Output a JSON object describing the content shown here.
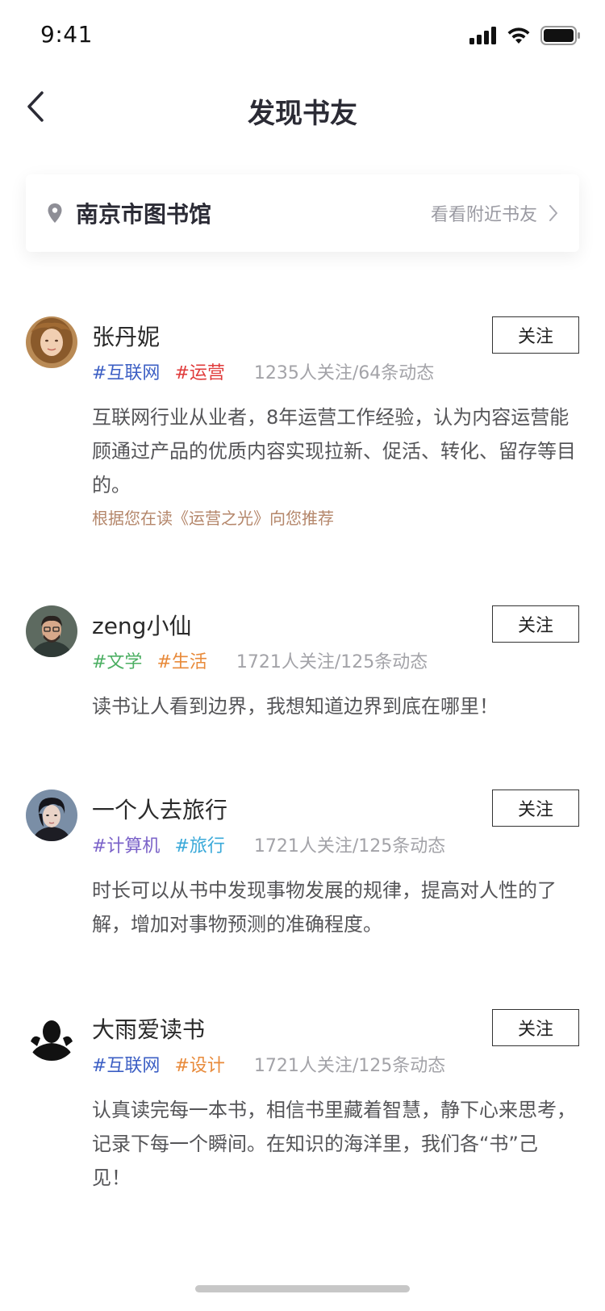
{
  "status_bar": {
    "time": "9:41"
  },
  "header": {
    "title": "发现书友"
  },
  "location": {
    "name": "南京市图书馆",
    "nearby_link": "看看附近书友"
  },
  "users": [
    {
      "name": "张丹妮",
      "tags": [
        {
          "text": "#互联网",
          "color": "#3c5fc4"
        },
        {
          "text": "#运营",
          "color": "#e03b3b"
        }
      ],
      "stats": "1235人关注/64条动态",
      "bio": "互联网行业从业者，8年运营工作经验，认为内容运营能顾通过产品的优质内容实现拉新、促活、转化、留存等目的。",
      "recommendation": "根据您在读《运营之光》向您推荐",
      "follow_label": "关注"
    },
    {
      "name": "zeng小仙",
      "tags": [
        {
          "text": "#文学",
          "color": "#4caf63"
        },
        {
          "text": "#生活",
          "color": "#e88a3a"
        }
      ],
      "stats": "1721人关注/125条动态",
      "bio": "读书让人看到边界，我想知道边界到底在哪里！",
      "follow_label": "关注"
    },
    {
      "name": "一个人去旅行",
      "tags": [
        {
          "text": "#计算机",
          "color": "#7b63c9"
        },
        {
          "text": "#旅行",
          "color": "#3aa9d9"
        }
      ],
      "stats": "1721人关注/125条动态",
      "bio": "时长可以从书中发现事物发展的规律，提高对人性的了解，增加对事物预测的准确程度。",
      "follow_label": "关注"
    },
    {
      "name": "大雨爱读书",
      "tags": [
        {
          "text": "#互联网",
          "color": "#3c5fc4"
        },
        {
          "text": "#设计",
          "color": "#e88a3a"
        }
      ],
      "stats": "1721人关注/125条动态",
      "bio": "认真读完每一本书，相信书里藏着智慧，静下心来思考，记录下每一个瞬间。在知识的海洋里，我们各“书”己见！",
      "follow_label": "关注"
    }
  ]
}
